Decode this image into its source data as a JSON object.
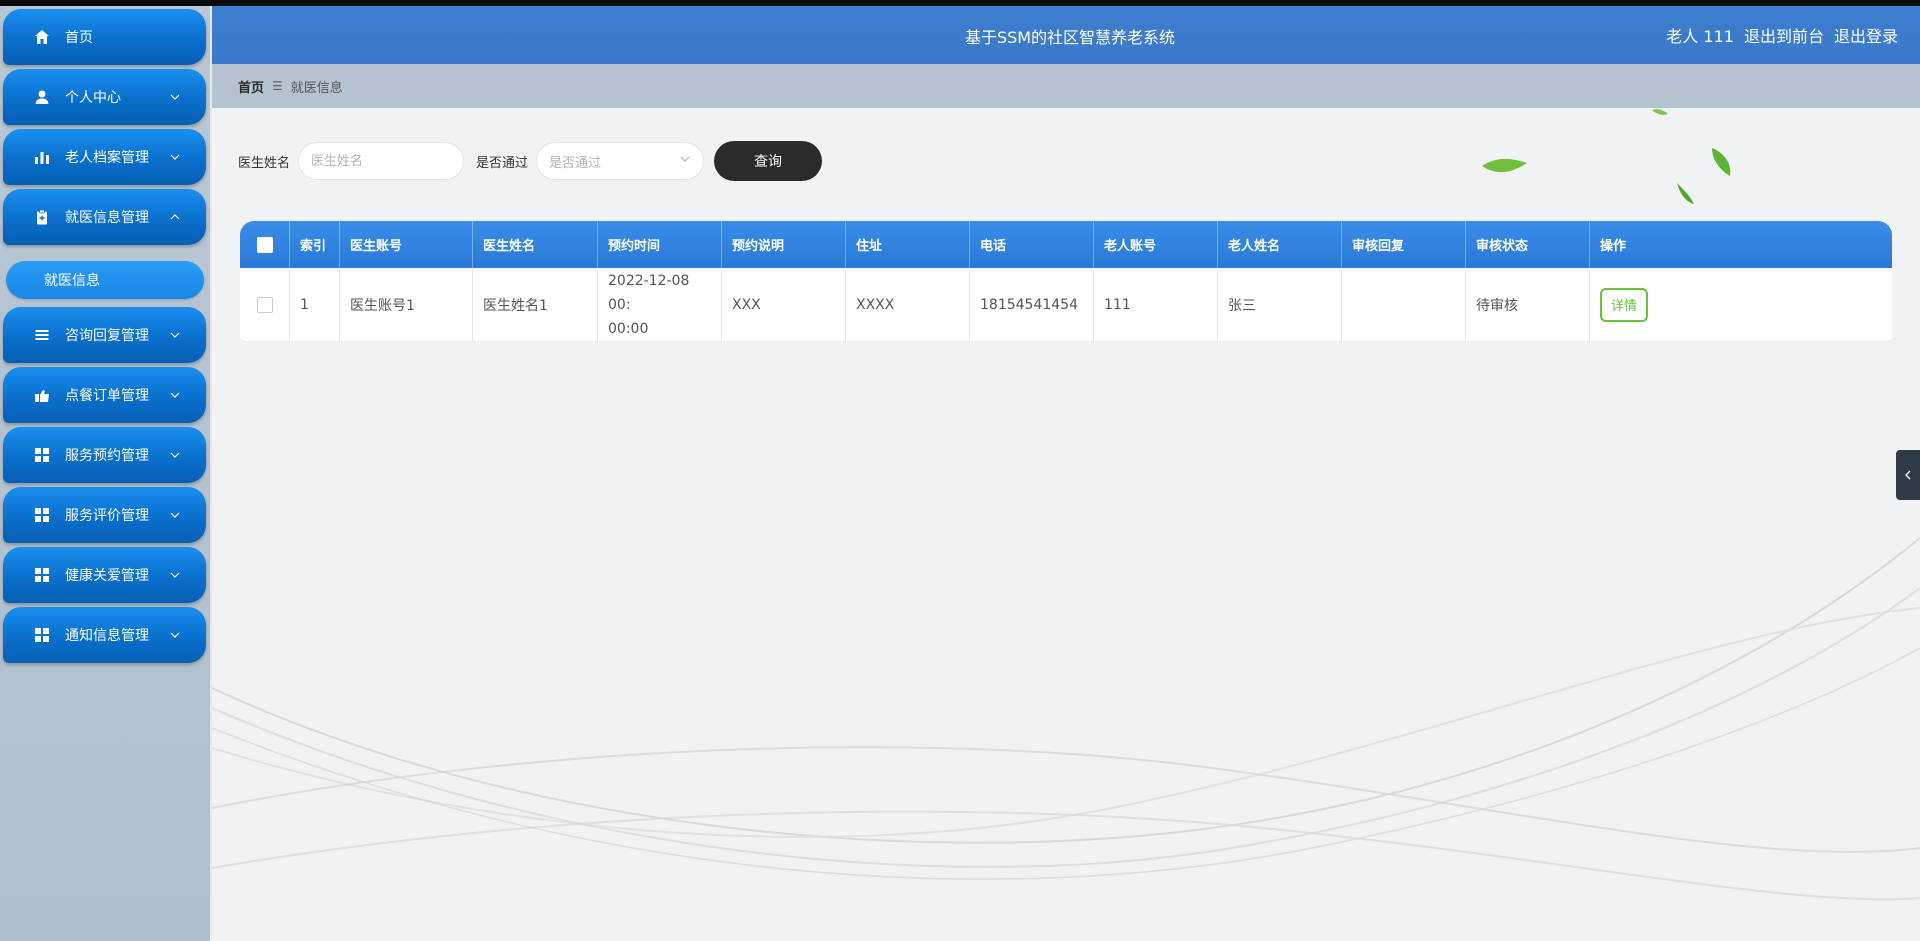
{
  "app": {
    "title": "基于SSM的社区智慧养老系统"
  },
  "header": {
    "user_label": "老人 111",
    "to_front": "退出到前台",
    "logout": "退出登录"
  },
  "sidebar": {
    "items": [
      {
        "label": "首页",
        "icon": "home-icon",
        "chevron": ""
      },
      {
        "label": "个人中心",
        "icon": "user-icon",
        "chevron": "down"
      },
      {
        "label": "老人档案管理",
        "icon": "bar-chart-icon",
        "chevron": "down"
      },
      {
        "label": "就医信息管理",
        "icon": "clipboard-icon",
        "chevron": "up"
      },
      {
        "label": "咨询回复管理",
        "icon": "list-icon",
        "chevron": "down"
      },
      {
        "label": "点餐订单管理",
        "icon": "cart-icon",
        "chevron": "down"
      },
      {
        "label": "服务预约管理",
        "icon": "grid-icon",
        "chevron": "down"
      },
      {
        "label": "服务评价管理",
        "icon": "grid-icon",
        "chevron": "down"
      },
      {
        "label": "健康关爱管理",
        "icon": "grid-icon",
        "chevron": "down"
      },
      {
        "label": "通知信息管理",
        "icon": "grid-icon",
        "chevron": "down"
      }
    ],
    "submenu_active": "就医信息"
  },
  "breadcrumb": {
    "home": "首页",
    "current": "就医信息"
  },
  "search": {
    "doctor_name_label": "医生姓名",
    "doctor_name_placeholder": "医生姓名",
    "approved_label": "是否通过",
    "approved_placeholder": "是否通过",
    "query_button": "查询"
  },
  "table": {
    "columns": [
      "索引",
      "医生账号",
      "医生姓名",
      "预约时间",
      "预约说明",
      "住址",
      "电话",
      "老人账号",
      "老人姓名",
      "审核回复",
      "审核状态",
      "操作"
    ],
    "rows": [
      {
        "index": "1",
        "doctor_account": "医生账号1",
        "doctor_name": "医生姓名1",
        "appointment_time_line1": "2022-12-08 00:",
        "appointment_time_line2": "00:00",
        "appointment_note": "XXX",
        "address": "XXXX",
        "phone": "18154541454",
        "elder_account": "111",
        "elder_name": "张三",
        "review_reply": "",
        "review_status": "待审核",
        "action": "详情"
      }
    ]
  },
  "colors": {
    "sidebar_button": "#0a6fcc",
    "header": "#3f7fcf",
    "table_header": "#2a78d6",
    "detail_button": "#67c23a",
    "query_button": "#2b2b2b"
  }
}
